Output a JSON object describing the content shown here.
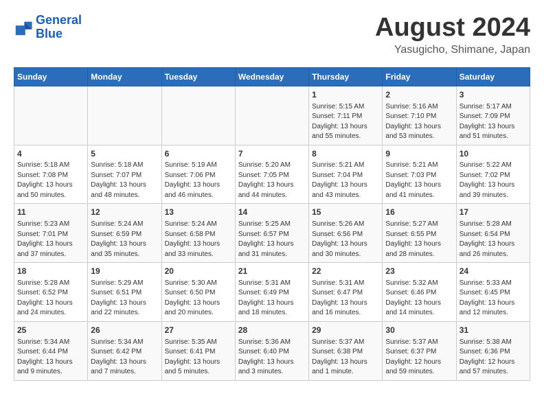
{
  "logo": {
    "line1": "General",
    "line2": "Blue"
  },
  "title": "August 2024",
  "location": "Yasugicho, Shimane, Japan",
  "weekdays": [
    "Sunday",
    "Monday",
    "Tuesday",
    "Wednesday",
    "Thursday",
    "Friday",
    "Saturday"
  ],
  "weeks": [
    [
      {
        "day": "",
        "info": ""
      },
      {
        "day": "",
        "info": ""
      },
      {
        "day": "",
        "info": ""
      },
      {
        "day": "",
        "info": ""
      },
      {
        "day": "1",
        "info": "Sunrise: 5:15 AM\nSunset: 7:11 PM\nDaylight: 13 hours\nand 55 minutes."
      },
      {
        "day": "2",
        "info": "Sunrise: 5:16 AM\nSunset: 7:10 PM\nDaylight: 13 hours\nand 53 minutes."
      },
      {
        "day": "3",
        "info": "Sunrise: 5:17 AM\nSunset: 7:09 PM\nDaylight: 13 hours\nand 51 minutes."
      }
    ],
    [
      {
        "day": "4",
        "info": "Sunrise: 5:18 AM\nSunset: 7:08 PM\nDaylight: 13 hours\nand 50 minutes."
      },
      {
        "day": "5",
        "info": "Sunrise: 5:18 AM\nSunset: 7:07 PM\nDaylight: 13 hours\nand 48 minutes."
      },
      {
        "day": "6",
        "info": "Sunrise: 5:19 AM\nSunset: 7:06 PM\nDaylight: 13 hours\nand 46 minutes."
      },
      {
        "day": "7",
        "info": "Sunrise: 5:20 AM\nSunset: 7:05 PM\nDaylight: 13 hours\nand 44 minutes."
      },
      {
        "day": "8",
        "info": "Sunrise: 5:21 AM\nSunset: 7:04 PM\nDaylight: 13 hours\nand 43 minutes."
      },
      {
        "day": "9",
        "info": "Sunrise: 5:21 AM\nSunset: 7:03 PM\nDaylight: 13 hours\nand 41 minutes."
      },
      {
        "day": "10",
        "info": "Sunrise: 5:22 AM\nSunset: 7:02 PM\nDaylight: 13 hours\nand 39 minutes."
      }
    ],
    [
      {
        "day": "11",
        "info": "Sunrise: 5:23 AM\nSunset: 7:01 PM\nDaylight: 13 hours\nand 37 minutes."
      },
      {
        "day": "12",
        "info": "Sunrise: 5:24 AM\nSunset: 6:59 PM\nDaylight: 13 hours\nand 35 minutes."
      },
      {
        "day": "13",
        "info": "Sunrise: 5:24 AM\nSunset: 6:58 PM\nDaylight: 13 hours\nand 33 minutes."
      },
      {
        "day": "14",
        "info": "Sunrise: 5:25 AM\nSunset: 6:57 PM\nDaylight: 13 hours\nand 31 minutes."
      },
      {
        "day": "15",
        "info": "Sunrise: 5:26 AM\nSunset: 6:56 PM\nDaylight: 13 hours\nand 30 minutes."
      },
      {
        "day": "16",
        "info": "Sunrise: 5:27 AM\nSunset: 6:55 PM\nDaylight: 13 hours\nand 28 minutes."
      },
      {
        "day": "17",
        "info": "Sunrise: 5:28 AM\nSunset: 6:54 PM\nDaylight: 13 hours\nand 26 minutes."
      }
    ],
    [
      {
        "day": "18",
        "info": "Sunrise: 5:28 AM\nSunset: 6:52 PM\nDaylight: 13 hours\nand 24 minutes."
      },
      {
        "day": "19",
        "info": "Sunrise: 5:29 AM\nSunset: 6:51 PM\nDaylight: 13 hours\nand 22 minutes."
      },
      {
        "day": "20",
        "info": "Sunrise: 5:30 AM\nSunset: 6:50 PM\nDaylight: 13 hours\nand 20 minutes."
      },
      {
        "day": "21",
        "info": "Sunrise: 5:31 AM\nSunset: 6:49 PM\nDaylight: 13 hours\nand 18 minutes."
      },
      {
        "day": "22",
        "info": "Sunrise: 5:31 AM\nSunset: 6:47 PM\nDaylight: 13 hours\nand 16 minutes."
      },
      {
        "day": "23",
        "info": "Sunrise: 5:32 AM\nSunset: 6:46 PM\nDaylight: 13 hours\nand 14 minutes."
      },
      {
        "day": "24",
        "info": "Sunrise: 5:33 AM\nSunset: 6:45 PM\nDaylight: 13 hours\nand 12 minutes."
      }
    ],
    [
      {
        "day": "25",
        "info": "Sunrise: 5:34 AM\nSunset: 6:44 PM\nDaylight: 13 hours\nand 9 minutes."
      },
      {
        "day": "26",
        "info": "Sunrise: 5:34 AM\nSunset: 6:42 PM\nDaylight: 13 hours\nand 7 minutes."
      },
      {
        "day": "27",
        "info": "Sunrise: 5:35 AM\nSunset: 6:41 PM\nDaylight: 13 hours\nand 5 minutes."
      },
      {
        "day": "28",
        "info": "Sunrise: 5:36 AM\nSunset: 6:40 PM\nDaylight: 13 hours\nand 3 minutes."
      },
      {
        "day": "29",
        "info": "Sunrise: 5:37 AM\nSunset: 6:38 PM\nDaylight: 13 hours\nand 1 minute."
      },
      {
        "day": "30",
        "info": "Sunrise: 5:37 AM\nSunset: 6:37 PM\nDaylight: 12 hours\nand 59 minutes."
      },
      {
        "day": "31",
        "info": "Sunrise: 5:38 AM\nSunset: 6:36 PM\nDaylight: 12 hours\nand 57 minutes."
      }
    ]
  ]
}
